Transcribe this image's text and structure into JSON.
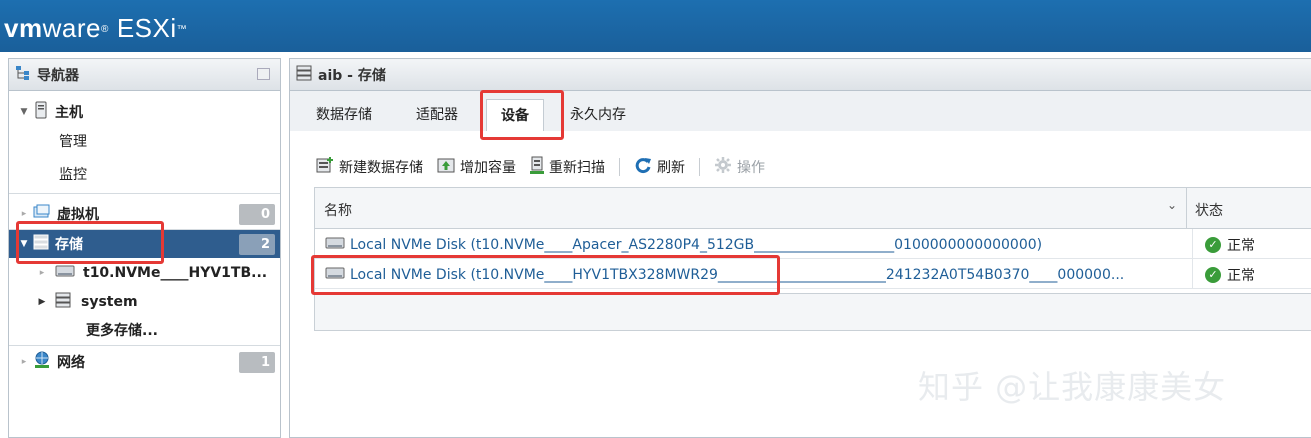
{
  "brand": {
    "vm": "vm",
    "ware": "ware",
    "reg": "®",
    "product": "ESXi",
    "tm": "™"
  },
  "navigator": {
    "title": "导航器",
    "host": {
      "label": "主机",
      "children": [
        "管理",
        "监控"
      ]
    },
    "vms": {
      "label": "虚拟机",
      "count": "0"
    },
    "storage": {
      "label": "存储",
      "count": "2",
      "children": [
        "t10.NVMe____HYV1TB...",
        "system",
        "更多存储..."
      ]
    },
    "network": {
      "label": "网络",
      "count": "1"
    }
  },
  "main": {
    "title": "aib - 存储",
    "tabs": [
      "数据存储",
      "适配器",
      "设备",
      "永久内存"
    ],
    "active_tab": "设备",
    "toolbar": {
      "new_datastore": "新建数据存储",
      "increase_capacity": "增加容量",
      "rescan": "重新扫描",
      "refresh": "刷新",
      "actions": "操作"
    },
    "table": {
      "columns": [
        "名称",
        "状态"
      ],
      "rows": [
        {
          "name": "Local NVMe Disk (t10.NVMe____Apacer_AS2280P4_512GB____________________0100000000000000)",
          "status": "正常"
        },
        {
          "name": "Local NVMe Disk (t10.NVMe____HYV1TBX328MWR29________________________241232A0T54B0370____000000...",
          "status": "正常"
        }
      ]
    }
  },
  "watermark": "知乎 @让我康康美女",
  "colors": {
    "header": "#1d6fb0",
    "selected": "#2f5d8e",
    "highlight": "#e53935",
    "link": "#1f5e97",
    "ok": "#3a9c3a"
  }
}
